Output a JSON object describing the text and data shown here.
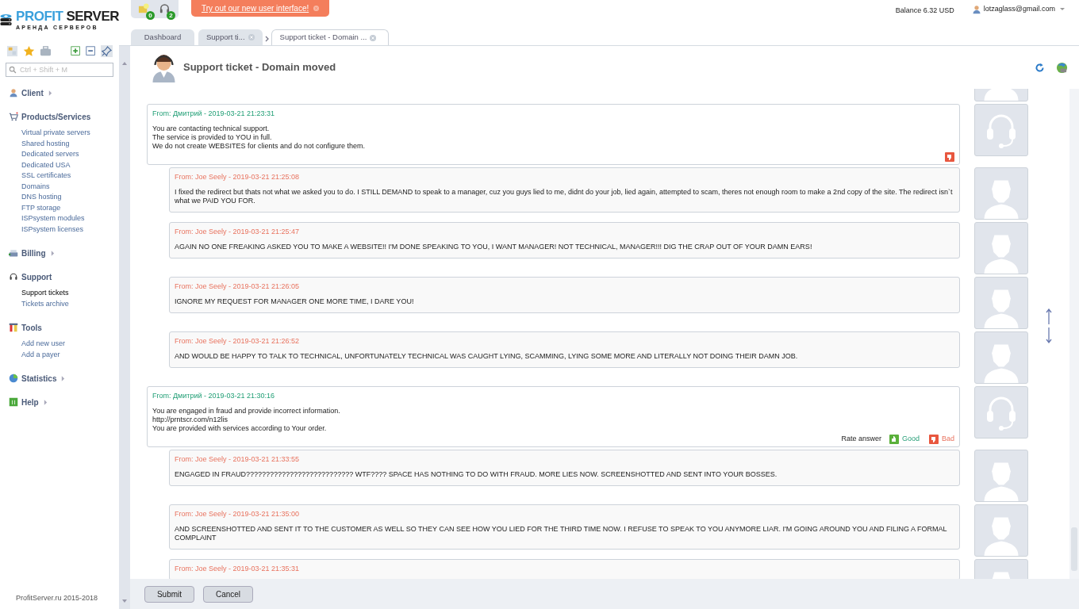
{
  "logo": {
    "brand_first": "PROFIT",
    "brand_second": "SERVER",
    "tagline": "АРЕНДА СЕРВЕРОВ"
  },
  "notifications": [
    {
      "count": "0"
    },
    {
      "count": "2"
    }
  ],
  "banner": {
    "text": "Try out our new user interface!"
  },
  "balance": "Balance 6.32 USD",
  "user": "lotzaglass@gmail.com",
  "tabs": [
    {
      "label": "Dashboard",
      "selected": false,
      "closable": false
    },
    {
      "label": "Support ti...",
      "selected": false,
      "closable": true
    },
    {
      "label": "Support ticket - Domain ...",
      "selected": true,
      "closable": true
    }
  ],
  "sidebar": {
    "search": {
      "placeholder": "Ctrl + Shift + M"
    },
    "sections": [
      {
        "title": "Client",
        "expandable": true
      },
      {
        "title": "Products/Services",
        "expandable": false,
        "items": [
          {
            "label": "Virtual private servers",
            "selected": false
          },
          {
            "label": "Shared hosting",
            "selected": false
          },
          {
            "label": "Dedicated servers",
            "selected": false
          },
          {
            "label": "Dedicated USA",
            "selected": false
          },
          {
            "label": "SSL certificates",
            "selected": false
          },
          {
            "label": "Domains",
            "selected": false
          },
          {
            "label": "DNS hosting",
            "selected": false
          },
          {
            "label": "FTP storage",
            "selected": false
          },
          {
            "label": "ISPsystem modules",
            "selected": false
          },
          {
            "label": "ISPsystem licenses",
            "selected": false
          }
        ]
      },
      {
        "title": "Billing",
        "expandable": true
      },
      {
        "title": "Support",
        "expandable": false,
        "items": [
          {
            "label": "Support tickets",
            "selected": true
          },
          {
            "label": "Tickets archive",
            "selected": false
          }
        ]
      },
      {
        "title": "Tools",
        "expandable": false,
        "items": [
          {
            "label": "Add new user",
            "selected": false
          },
          {
            "label": "Add a payer",
            "selected": false
          }
        ]
      },
      {
        "title": "Statistics",
        "expandable": true
      },
      {
        "title": "Help",
        "expandable": true
      }
    ],
    "footer": "ProfitServer.ru 2015-2018"
  },
  "page_title": "Support ticket - Domain moved",
  "messages": [
    {
      "kind": "staff",
      "from": "From: Дмитрий - 2019-03-21 21:23:31",
      "body": [
        "You are contacting technical support.",
        "The service is provided to YOU in full.",
        "We do not create WEBSITES for clients and do not configure them."
      ],
      "complaint_button": true
    },
    {
      "kind": "client",
      "from": "From: Joe Seely - 2019-03-21 21:25:08",
      "body": [
        "I fixed the redirect but thats not what we asked you to do. I STILL DEMAND to speak to a manager, cuz you guys lied to me, didnt do your job, lied again, attempted to scam, theres not enough room to make a 2nd copy of the site. The redirect isn`t what we PAID YOU FOR."
      ]
    },
    {
      "kind": "client",
      "from": "From: Joe Seely - 2019-03-21 21:25:47",
      "body": [
        "AGAIN NO ONE FREAKING ASKED YOU TO MAKE A WEBSITE!! I'M DONE SPEAKING TO YOU, I WANT MANAGER! NOT TECHNICAL, MANAGER!!! DIG THE CRAP OUT OF YOUR DAMN EARS!"
      ]
    },
    {
      "kind": "client",
      "from": "From: Joe Seely - 2019-03-21 21:26:05",
      "body": [
        "IGNORE MY REQUEST FOR MANAGER ONE MORE TIME, I DARE YOU!"
      ]
    },
    {
      "kind": "client",
      "from": "From: Joe Seely - 2019-03-21 21:26:52",
      "body": [
        "AND WOULD BE HAPPY TO TALK TO TECHNICAL, UNFORTUNATELY TECHNICAL WAS CAUGHT LYING, SCAMMING, LYING SOME MORE AND LITERALLY NOT DOING THEIR DAMN JOB."
      ]
    },
    {
      "kind": "staff",
      "from": "From: Дмитрий - 2019-03-21 21:30:16",
      "body": [
        "You are engaged in fraud and provide incorrect information.",
        "http://prntscr.com/n12lis",
        "You are provided with services according to Your order."
      ],
      "rating": {
        "label": "Rate answer",
        "good": "Good",
        "bad": "Bad"
      }
    },
    {
      "kind": "client",
      "from": "From: Joe Seely - 2019-03-21 21:33:55",
      "body": [
        "ENGAGED IN FRAUD??????????????????????????? WTF???? SPACE HAS NOTHING TO DO WITH FRAUD. MORE LIES NOW. SCREENSHOTTED AND SENT INTO YOUR BOSSES."
      ]
    },
    {
      "kind": "client",
      "from": "From: Joe Seely - 2019-03-21 21:35:00",
      "body": [
        "AND SCREENSHOTTED AND SENT IT TO THE CUSTOMER AS WELL SO THEY CAN SEE HOW YOU LIED FOR THE THIRD TIME NOW. I REFUSE TO SPEAK TO YOU ANYMORE LIAR. I'M GOING AROUND YOU AND FILING A FORMAL COMPLAINT"
      ]
    },
    {
      "kind": "client",
      "from": "From: Joe Seely - 2019-03-21 21:35:31"
    }
  ],
  "buttons": [
    "Submit",
    "Cancel"
  ]
}
